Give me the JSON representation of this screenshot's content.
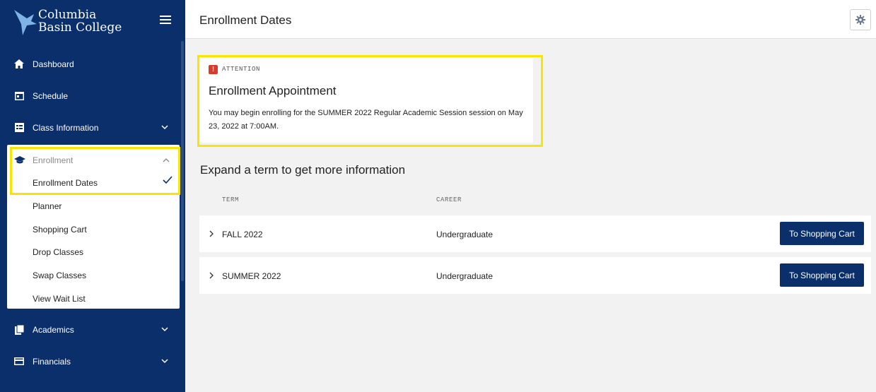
{
  "brand": {
    "line1": "Columbia",
    "line2": "Basin College",
    "colors": {
      "sidebar": "#0b2f6b",
      "highlight": "#f7e600",
      "alert": "#d93a2b"
    }
  },
  "sidebar": {
    "items": [
      {
        "label": "Dashboard",
        "icon": "home-icon"
      },
      {
        "label": "Schedule",
        "icon": "calendar-icon"
      },
      {
        "label": "Class Information",
        "icon": "class-info-icon"
      },
      {
        "label": "Academics",
        "icon": "academics-icon"
      },
      {
        "label": "Financials",
        "icon": "credit-card-icon"
      }
    ],
    "enrollment": {
      "label": "Enrollment",
      "icon": "graduation-cap-icon",
      "sub_items": [
        "Enrollment Dates",
        "Planner",
        "Shopping Cart",
        "Drop Classes",
        "Swap Classes",
        "View Wait List"
      ],
      "selected": "Enrollment Dates"
    }
  },
  "header": {
    "title": "Enrollment Dates"
  },
  "attention": {
    "label": "ATTENTION",
    "title": "Enrollment Appointment",
    "message": "You may begin enrolling for the SUMMER 2022 Regular Academic Session session on May 23, 2022 at 7:00AM."
  },
  "terms": {
    "heading": "Expand a term to get more information",
    "columns": {
      "term": "TERM",
      "career": "CAREER"
    },
    "rows": [
      {
        "term": "FALL 2022",
        "career": "Undergraduate",
        "button": "To Shopping Cart"
      },
      {
        "term": "SUMMER 2022",
        "career": "Undergraduate",
        "button": "To Shopping Cart"
      }
    ]
  }
}
